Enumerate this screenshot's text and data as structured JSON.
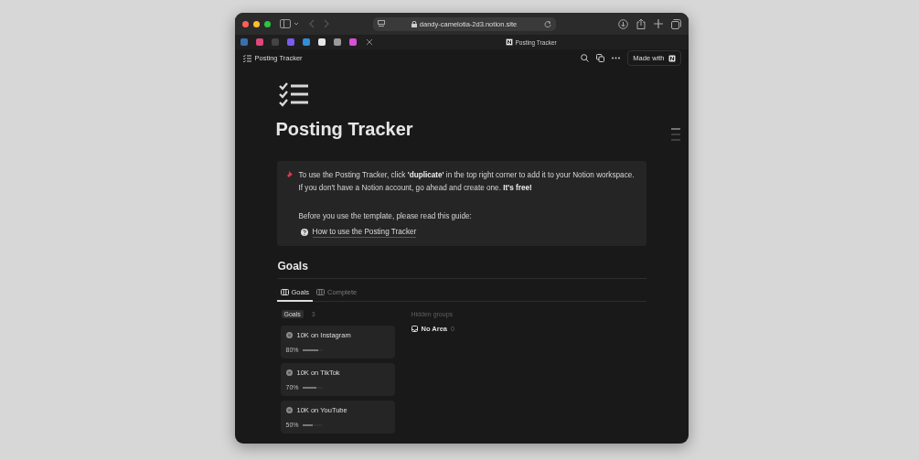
{
  "browser": {
    "url": "dandy-camelotia-2d3.notion.site",
    "pinned_tabs": [
      {
        "color": "#3a6fb0"
      },
      {
        "color": "#e0457b"
      },
      {
        "color": "#444444"
      },
      {
        "color": "#7a5cf0"
      },
      {
        "color": "#2f8fd8"
      },
      {
        "color": "#e8e8e8"
      },
      {
        "color": "#9a9a9a"
      },
      {
        "color": "#d84fd8"
      }
    ],
    "active_tab": "Posting Tracker"
  },
  "topbar": {
    "breadcrumb": "Posting Tracker",
    "made_with": "Made with"
  },
  "page": {
    "title": "Posting Tracker",
    "callout": {
      "lines": [
        "To use the Posting Tracker, click **'duplicate'** in the top right corner to add it to your Notion workspace.",
        "If you don't have a Notion account, go ahead and create one. **It's free!**"
      ],
      "guide_intro": "Before you use the template, please read this guide:",
      "guide_link": "How to use the Posting Tracker"
    },
    "section": "Goals",
    "views": [
      {
        "label": "Goals",
        "selected": true
      },
      {
        "label": "Complete",
        "selected": false
      }
    ],
    "board": {
      "group": "Goals",
      "count": "3",
      "cards": [
        {
          "title": "10K on Instagram",
          "percent": "80%",
          "level": 0.8
        },
        {
          "title": "10K on TikTok",
          "percent": "70%",
          "level": 0.7
        },
        {
          "title": "10K on YouTube",
          "percent": "50%",
          "level": 0.5
        }
      ],
      "hidden_label": "Hidden groups",
      "hidden_groups": [
        {
          "name": "No Area",
          "count": "0"
        }
      ]
    }
  }
}
